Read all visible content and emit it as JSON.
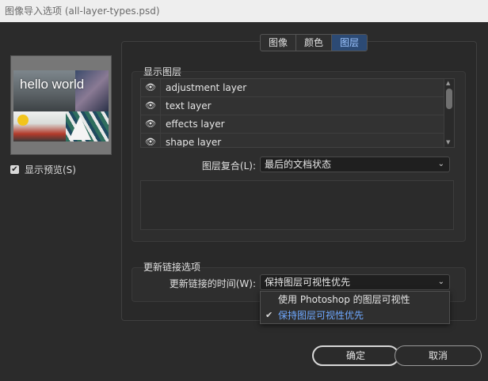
{
  "window": {
    "title": "图像导入选项 (all-layer-types.psd)"
  },
  "preview": {
    "overlay_text": "hello world",
    "show_preview_label": "显示预览(S)",
    "show_preview_checked": true
  },
  "tabs": [
    {
      "label": "图像",
      "active": false
    },
    {
      "label": "颜色",
      "active": false
    },
    {
      "label": "图层",
      "active": true
    }
  ],
  "layers_section": {
    "title": "显示图层",
    "items": [
      {
        "name": "adjustment layer",
        "icon": "eye-icon"
      },
      {
        "name": "text layer",
        "icon": "eye-icon"
      },
      {
        "name": "effects layer",
        "icon": "eye-icon"
      },
      {
        "name": "shape layer",
        "icon": "eye-icon"
      }
    ],
    "comp_label": "图层复合(L):",
    "comp_value": "最后的文档状态"
  },
  "links_section": {
    "title": "更新链接选项",
    "when_label": "更新链接的时间(W):",
    "when_value": "保持图层可视性优先",
    "options": [
      {
        "label": "使用 Photoshop 的图层可视性",
        "selected": false
      },
      {
        "label": "保持图层可视性优先",
        "selected": true
      }
    ]
  },
  "buttons": {
    "ok": "确定",
    "cancel": "取消"
  },
  "colors": {
    "accent": "#6ea8ff",
    "tab_active_bg": "#2c4a74"
  }
}
